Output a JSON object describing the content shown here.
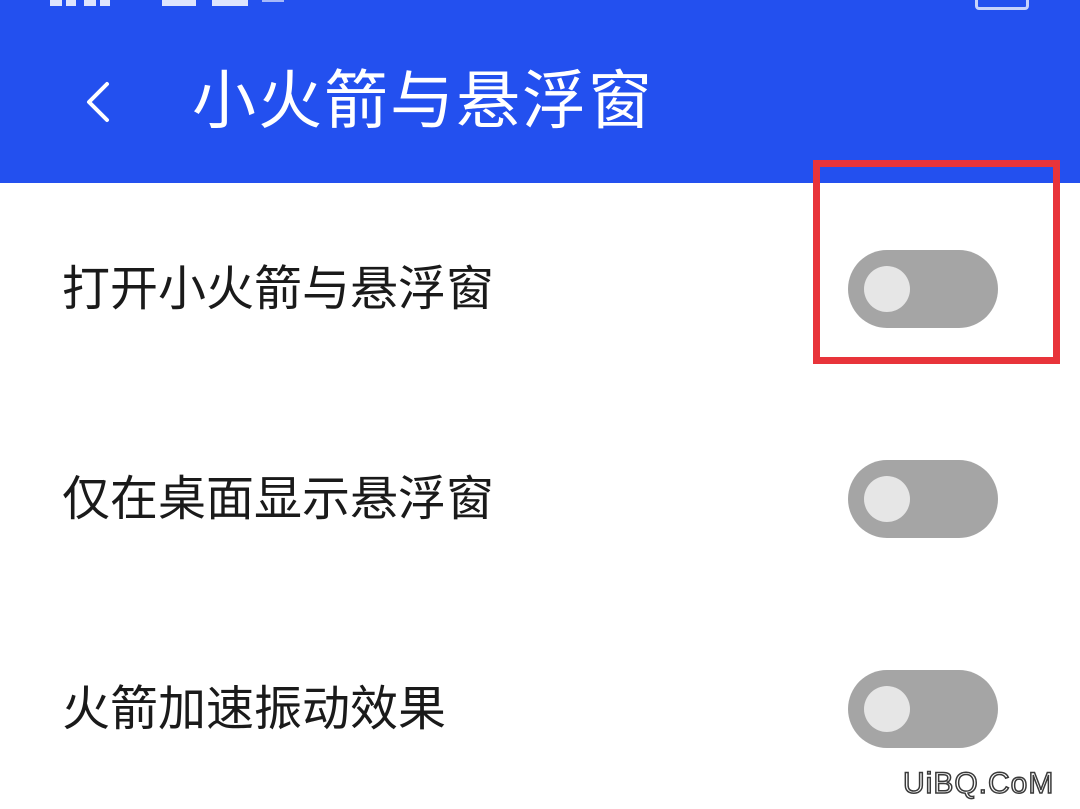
{
  "header": {
    "title": "小火箭与悬浮窗",
    "back_icon": "chevron-left-icon",
    "background_color": "#2350ef"
  },
  "settings": [
    {
      "label": "打开小火箭与悬浮窗",
      "enabled": false
    },
    {
      "label": "仅在桌面显示悬浮窗",
      "enabled": false
    },
    {
      "label": "火箭加速振动效果",
      "enabled": false
    }
  ],
  "highlight_color": "#e8343a",
  "watermark": "UiBQ.CoM"
}
